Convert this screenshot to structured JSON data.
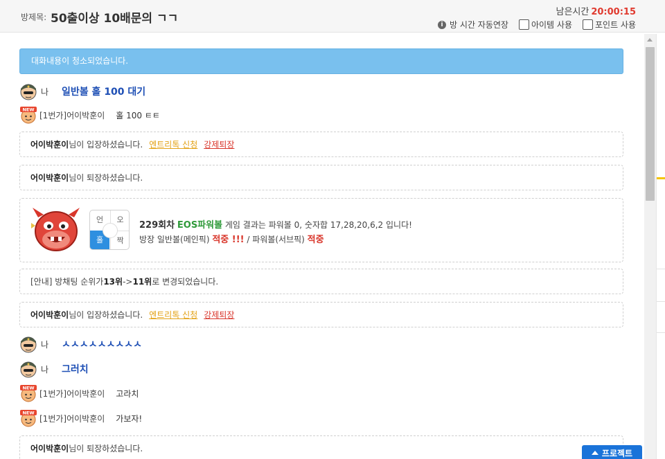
{
  "header": {
    "room_label": "방제목:",
    "room_title": "50출이상 10배문의 ㄱㄱ",
    "remaining_label": "남은시간",
    "remaining_time": "20:00:15",
    "options": {
      "auto_extend": "방 시간 자동연장",
      "item_use": "아이템 사용",
      "point_use": "포인트 사용"
    }
  },
  "chat": {
    "cleared_notice": "대화내용이 청소되었습니다.",
    "me_label": "나",
    "messages": {
      "m1_text": "일반볼 홀 100 대기",
      "u1_name": "[1번가]어이박훈이",
      "u1_text": "홀 100 ㅌㅌ",
      "s1_user": "어이박훈이",
      "s1_text": "님이 입장하셨습니다.",
      "s1_entry": "엔트리톡 신청",
      "s1_kick": "강제퇴장",
      "s2_user": "어이박훈이",
      "s2_text": "님이 퇴장하셨습니다.",
      "s3_text1": "[안내] 방채팅 순위가 ",
      "s3_from": "13위",
      "s3_arrow": " -> ",
      "s3_to": "11위",
      "s3_text2": " 로 변경되었습니다.",
      "s4_user": "어이박훈이",
      "s4_text": "님이 입장하셨습니다.",
      "s4_entry": "엔트리톡 신청",
      "s4_kick": "강제퇴장",
      "m2_text": "ㅅㅅㅅㅅㅅㅅㅅㅅㅅ",
      "m3_text": "그러치",
      "u2_name": "[1번가]어이박훈이",
      "u2_text": "고라치",
      "u3_name": "[1번가]어이박훈이",
      "u3_text": "가보자!",
      "s5_user": "어이박훈이",
      "s5_text": "님이 퇴장하셨습니다."
    },
    "result": {
      "round": "229회차",
      "game": "EOS파워볼",
      "line1_text": " 게임 결과는 파워볼 0, 숫자합 17,28,20,6,2 입니다!",
      "line2_pre": "방장 일반볼(메인픽) ",
      "hit1": "적중 !!!",
      "line2_mid": " / 파워볼(서브픽) ",
      "hit2": "적중",
      "grid": [
        "언",
        "오",
        "홀",
        "짝"
      ]
    }
  },
  "protect_button": "프로젝트",
  "colors": {
    "notice_bg": "#79c0ee",
    "me_text": "#1e4fb5",
    "time_red": "#e03a2f",
    "entry_link": "#e3a216",
    "kick_link": "#d9362b",
    "game_green": "#2f9a3a",
    "grid_active": "#2e8fe0",
    "protect_bg": "#1a73d9"
  },
  "icons": {
    "me_avatar": "soldier-avatar-icon",
    "user_avatar": "new-user-avatar-icon",
    "result": "red-devil-icon",
    "info": "info-icon"
  }
}
